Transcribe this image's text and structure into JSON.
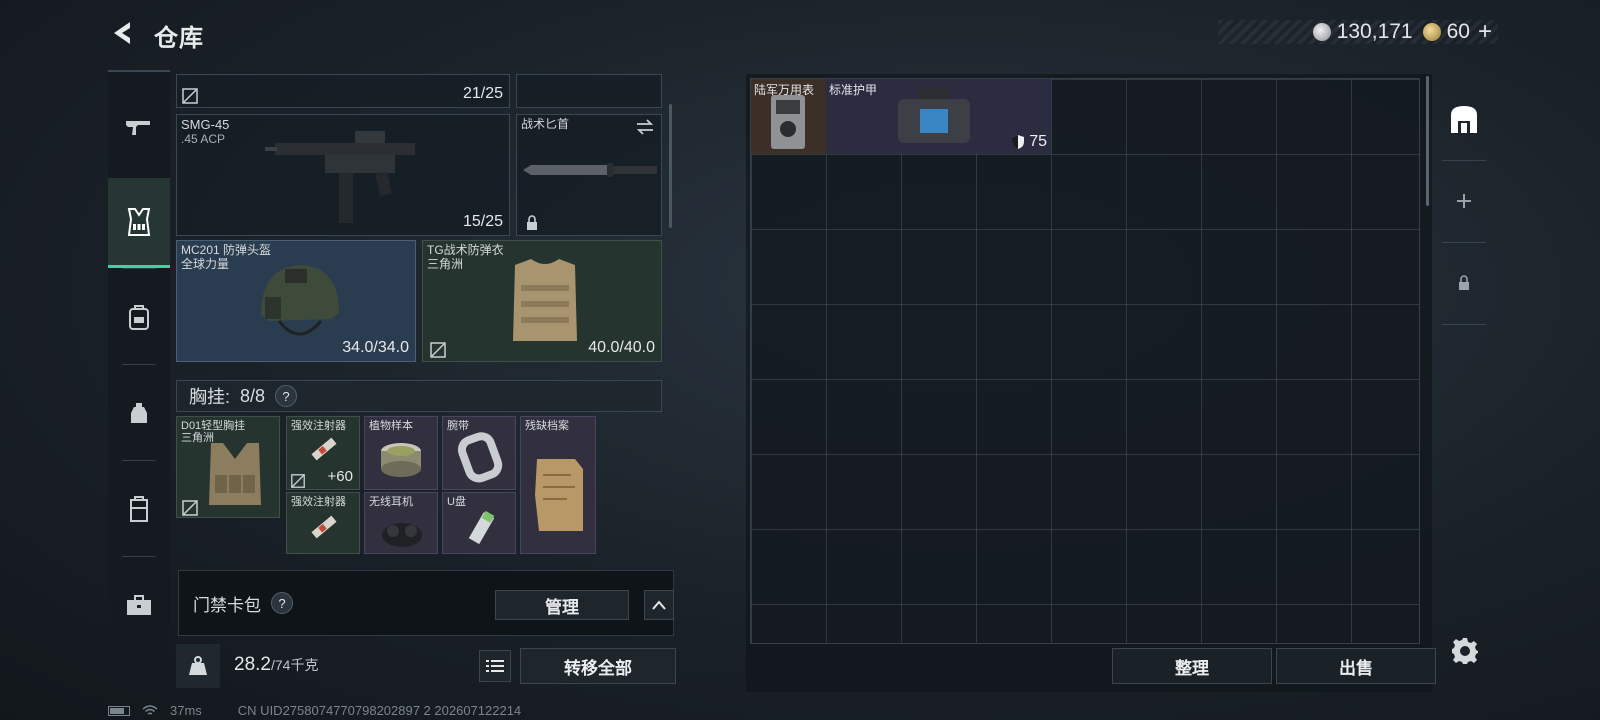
{
  "header": {
    "title": "仓库"
  },
  "currency": {
    "silver": "130,171",
    "gold": "60",
    "add": "+"
  },
  "categories": [
    {
      "id": "weapons",
      "icon": "gun-icon"
    },
    {
      "id": "gear",
      "icon": "vest-icon",
      "active": true
    },
    {
      "id": "backpack",
      "icon": "backpack-icon"
    },
    {
      "id": "pouch",
      "icon": "pouch-icon"
    },
    {
      "id": "container",
      "icon": "container-icon"
    },
    {
      "id": "case",
      "icon": "briefcase-icon"
    }
  ],
  "loadout": {
    "top_slot": {
      "durability": "21/25"
    },
    "primary": {
      "name": "SMG-45",
      "ammo": ".45 ACP",
      "durability": "15/25"
    },
    "melee": {
      "name": "战术匕首"
    },
    "helmet": {
      "name": "MC201 防弹头盔",
      "faction": "全球力量",
      "durability": "34.0/34.0"
    },
    "armor": {
      "name": "TG战术防弹衣",
      "faction": "三角洲",
      "durability": "40.0/40.0"
    },
    "vest": {
      "label": "胸挂:",
      "count": "8/8",
      "help": "?"
    },
    "vest_items": [
      {
        "name": "D01轻型胸挂",
        "sub": "三角洲"
      },
      {
        "name": "强效注射器",
        "value": "+60"
      },
      {
        "name": "强效注射器"
      },
      {
        "name": "植物样本"
      },
      {
        "name": "无线耳机"
      },
      {
        "name": "腕带"
      },
      {
        "name": "U盘"
      },
      {
        "name": "残缺档案"
      }
    ]
  },
  "keycard": {
    "label": "门禁卡包",
    "help": "?",
    "manage": "管理"
  },
  "weight": {
    "current": "28.2",
    "capacity": "/74千克"
  },
  "transfer_all": "转移全部",
  "stash": {
    "items": [
      {
        "name": "陆军万用表"
      },
      {
        "name": "标准护甲",
        "value": "75"
      }
    ],
    "sort": "整理",
    "sell": "出售"
  },
  "status": {
    "ping": "37ms",
    "uid": "CN UID2758074770798202897 2 202607122214"
  },
  "colors": {
    "accent": "#3ad5a3",
    "background": "#1a2128"
  }
}
